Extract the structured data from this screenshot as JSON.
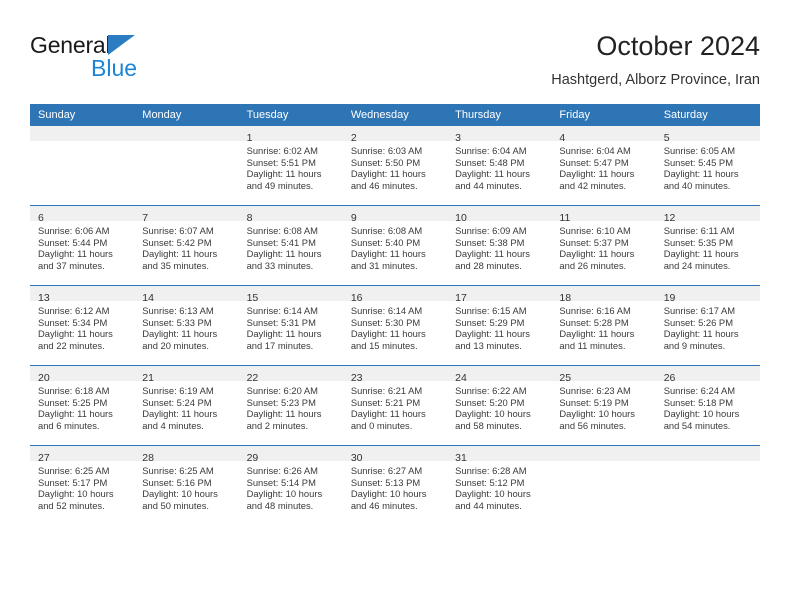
{
  "brand": {
    "line1": "General",
    "line2": "Blue",
    "triangle_color": "#2b7cc0",
    "line2_color": "#1b86d6"
  },
  "header": {
    "title": "October 2024",
    "subtitle": "Hashtgerd, Alborz Province, Iran"
  },
  "theme": {
    "header_blue": "#2e75b6",
    "daynum_band": "#f0f0f0",
    "text": "#3a3a3a"
  },
  "calendar": {
    "weekday_headers": [
      "Sunday",
      "Monday",
      "Tuesday",
      "Wednesday",
      "Thursday",
      "Friday",
      "Saturday"
    ],
    "weeks": [
      [
        {
          "day": "",
          "empty": true
        },
        {
          "day": "",
          "empty": true
        },
        {
          "day": "1",
          "sunrise": "Sunrise: 6:02 AM",
          "sunset": "Sunset: 5:51 PM",
          "daylight1": "Daylight: 11 hours",
          "daylight2": "and 49 minutes."
        },
        {
          "day": "2",
          "sunrise": "Sunrise: 6:03 AM",
          "sunset": "Sunset: 5:50 PM",
          "daylight1": "Daylight: 11 hours",
          "daylight2": "and 46 minutes."
        },
        {
          "day": "3",
          "sunrise": "Sunrise: 6:04 AM",
          "sunset": "Sunset: 5:48 PM",
          "daylight1": "Daylight: 11 hours",
          "daylight2": "and 44 minutes."
        },
        {
          "day": "4",
          "sunrise": "Sunrise: 6:04 AM",
          "sunset": "Sunset: 5:47 PM",
          "daylight1": "Daylight: 11 hours",
          "daylight2": "and 42 minutes."
        },
        {
          "day": "5",
          "sunrise": "Sunrise: 6:05 AM",
          "sunset": "Sunset: 5:45 PM",
          "daylight1": "Daylight: 11 hours",
          "daylight2": "and 40 minutes."
        }
      ],
      [
        {
          "day": "6",
          "sunrise": "Sunrise: 6:06 AM",
          "sunset": "Sunset: 5:44 PM",
          "daylight1": "Daylight: 11 hours",
          "daylight2": "and 37 minutes."
        },
        {
          "day": "7",
          "sunrise": "Sunrise: 6:07 AM",
          "sunset": "Sunset: 5:42 PM",
          "daylight1": "Daylight: 11 hours",
          "daylight2": "and 35 minutes."
        },
        {
          "day": "8",
          "sunrise": "Sunrise: 6:08 AM",
          "sunset": "Sunset: 5:41 PM",
          "daylight1": "Daylight: 11 hours",
          "daylight2": "and 33 minutes."
        },
        {
          "day": "9",
          "sunrise": "Sunrise: 6:08 AM",
          "sunset": "Sunset: 5:40 PM",
          "daylight1": "Daylight: 11 hours",
          "daylight2": "and 31 minutes."
        },
        {
          "day": "10",
          "sunrise": "Sunrise: 6:09 AM",
          "sunset": "Sunset: 5:38 PM",
          "daylight1": "Daylight: 11 hours",
          "daylight2": "and 28 minutes."
        },
        {
          "day": "11",
          "sunrise": "Sunrise: 6:10 AM",
          "sunset": "Sunset: 5:37 PM",
          "daylight1": "Daylight: 11 hours",
          "daylight2": "and 26 minutes."
        },
        {
          "day": "12",
          "sunrise": "Sunrise: 6:11 AM",
          "sunset": "Sunset: 5:35 PM",
          "daylight1": "Daylight: 11 hours",
          "daylight2": "and 24 minutes."
        }
      ],
      [
        {
          "day": "13",
          "sunrise": "Sunrise: 6:12 AM",
          "sunset": "Sunset: 5:34 PM",
          "daylight1": "Daylight: 11 hours",
          "daylight2": "and 22 minutes."
        },
        {
          "day": "14",
          "sunrise": "Sunrise: 6:13 AM",
          "sunset": "Sunset: 5:33 PM",
          "daylight1": "Daylight: 11 hours",
          "daylight2": "and 20 minutes."
        },
        {
          "day": "15",
          "sunrise": "Sunrise: 6:14 AM",
          "sunset": "Sunset: 5:31 PM",
          "daylight1": "Daylight: 11 hours",
          "daylight2": "and 17 minutes."
        },
        {
          "day": "16",
          "sunrise": "Sunrise: 6:14 AM",
          "sunset": "Sunset: 5:30 PM",
          "daylight1": "Daylight: 11 hours",
          "daylight2": "and 15 minutes."
        },
        {
          "day": "17",
          "sunrise": "Sunrise: 6:15 AM",
          "sunset": "Sunset: 5:29 PM",
          "daylight1": "Daylight: 11 hours",
          "daylight2": "and 13 minutes."
        },
        {
          "day": "18",
          "sunrise": "Sunrise: 6:16 AM",
          "sunset": "Sunset: 5:28 PM",
          "daylight1": "Daylight: 11 hours",
          "daylight2": "and 11 minutes."
        },
        {
          "day": "19",
          "sunrise": "Sunrise: 6:17 AM",
          "sunset": "Sunset: 5:26 PM",
          "daylight1": "Daylight: 11 hours",
          "daylight2": "and 9 minutes."
        }
      ],
      [
        {
          "day": "20",
          "sunrise": "Sunrise: 6:18 AM",
          "sunset": "Sunset: 5:25 PM",
          "daylight1": "Daylight: 11 hours",
          "daylight2": "and 6 minutes."
        },
        {
          "day": "21",
          "sunrise": "Sunrise: 6:19 AM",
          "sunset": "Sunset: 5:24 PM",
          "daylight1": "Daylight: 11 hours",
          "daylight2": "and 4 minutes."
        },
        {
          "day": "22",
          "sunrise": "Sunrise: 6:20 AM",
          "sunset": "Sunset: 5:23 PM",
          "daylight1": "Daylight: 11 hours",
          "daylight2": "and 2 minutes."
        },
        {
          "day": "23",
          "sunrise": "Sunrise: 6:21 AM",
          "sunset": "Sunset: 5:21 PM",
          "daylight1": "Daylight: 11 hours",
          "daylight2": "and 0 minutes."
        },
        {
          "day": "24",
          "sunrise": "Sunrise: 6:22 AM",
          "sunset": "Sunset: 5:20 PM",
          "daylight1": "Daylight: 10 hours",
          "daylight2": "and 58 minutes."
        },
        {
          "day": "25",
          "sunrise": "Sunrise: 6:23 AM",
          "sunset": "Sunset: 5:19 PM",
          "daylight1": "Daylight: 10 hours",
          "daylight2": "and 56 minutes."
        },
        {
          "day": "26",
          "sunrise": "Sunrise: 6:24 AM",
          "sunset": "Sunset: 5:18 PM",
          "daylight1": "Daylight: 10 hours",
          "daylight2": "and 54 minutes."
        }
      ],
      [
        {
          "day": "27",
          "sunrise": "Sunrise: 6:25 AM",
          "sunset": "Sunset: 5:17 PM",
          "daylight1": "Daylight: 10 hours",
          "daylight2": "and 52 minutes."
        },
        {
          "day": "28",
          "sunrise": "Sunrise: 6:25 AM",
          "sunset": "Sunset: 5:16 PM",
          "daylight1": "Daylight: 10 hours",
          "daylight2": "and 50 minutes."
        },
        {
          "day": "29",
          "sunrise": "Sunrise: 6:26 AM",
          "sunset": "Sunset: 5:14 PM",
          "daylight1": "Daylight: 10 hours",
          "daylight2": "and 48 minutes."
        },
        {
          "day": "30",
          "sunrise": "Sunrise: 6:27 AM",
          "sunset": "Sunset: 5:13 PM",
          "daylight1": "Daylight: 10 hours",
          "daylight2": "and 46 minutes."
        },
        {
          "day": "31",
          "sunrise": "Sunrise: 6:28 AM",
          "sunset": "Sunset: 5:12 PM",
          "daylight1": "Daylight: 10 hours",
          "daylight2": "and 44 minutes."
        },
        {
          "day": "",
          "empty": true
        },
        {
          "day": "",
          "empty": true
        }
      ]
    ]
  }
}
